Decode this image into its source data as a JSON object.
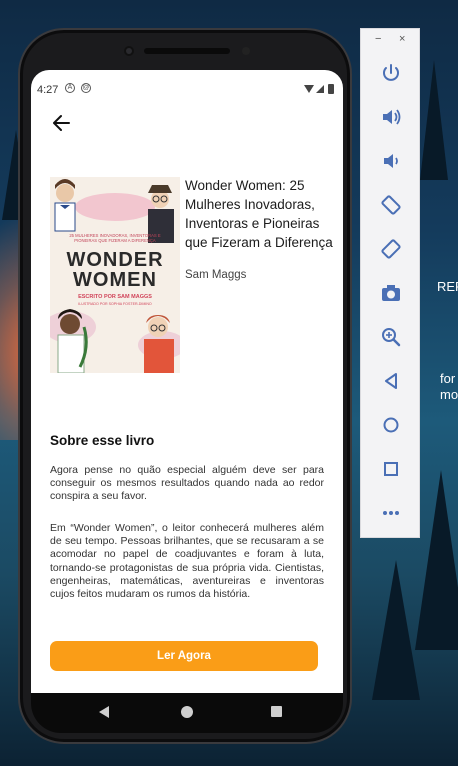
{
  "status_bar": {
    "time": "4:27"
  },
  "book": {
    "title": "Wonder Women: 25 Mulheres Inovadoras, Inventoras e Pioneiras que Fizeram a Diferença",
    "author": "Sam Maggs",
    "cover": {
      "subtitle": "25 MULHERES INOVADORAS, INVENTORAS E PIONEIRAS QUE FIZERAM A DIFERENÇA",
      "title_line1": "WONDER",
      "title_line2": "WOMEN",
      "byline": "ESCRITO POR SAM MAGGS",
      "illustrator": "ILUSTRADO POR SOPHIA FOSTER-DIMINO"
    }
  },
  "about": {
    "heading": "Sobre esse livro",
    "paragraph1": "Agora pense no quão especial alguém deve ser para conseguir os mesmos resultados quando nada ao redor conspira a seu favor.",
    "paragraph2": "Em “Wonder Women”, o leitor conhecerá mulheres além de seu tempo. Pessoas brilhantes, que se recusaram a se acomodar no papel de coadjuvantes e foram à luta, tornando-se protagonistas de sua própria vida. Cientistas, engenheiras, matemáticas, aventureiras e inventoras cujos feitos mudaram os rumos da história."
  },
  "read_button": {
    "label": "Ler Agora"
  },
  "toolbar": {
    "minimize_label": "−",
    "close_label": "×",
    "buttons": [
      "power-icon",
      "volume-up-icon",
      "volume-down-icon",
      "rotate-left-icon",
      "rotate-right-icon",
      "camera-icon",
      "zoom-icon",
      "back-icon",
      "home-icon",
      "overview-icon",
      "more-icon"
    ]
  },
  "background_text": {
    "line1": "REF",
    "line2": "for",
    "line3": "mo"
  },
  "colors": {
    "accent": "#fa9d17",
    "toolbar_icon": "#4a6fb5"
  }
}
